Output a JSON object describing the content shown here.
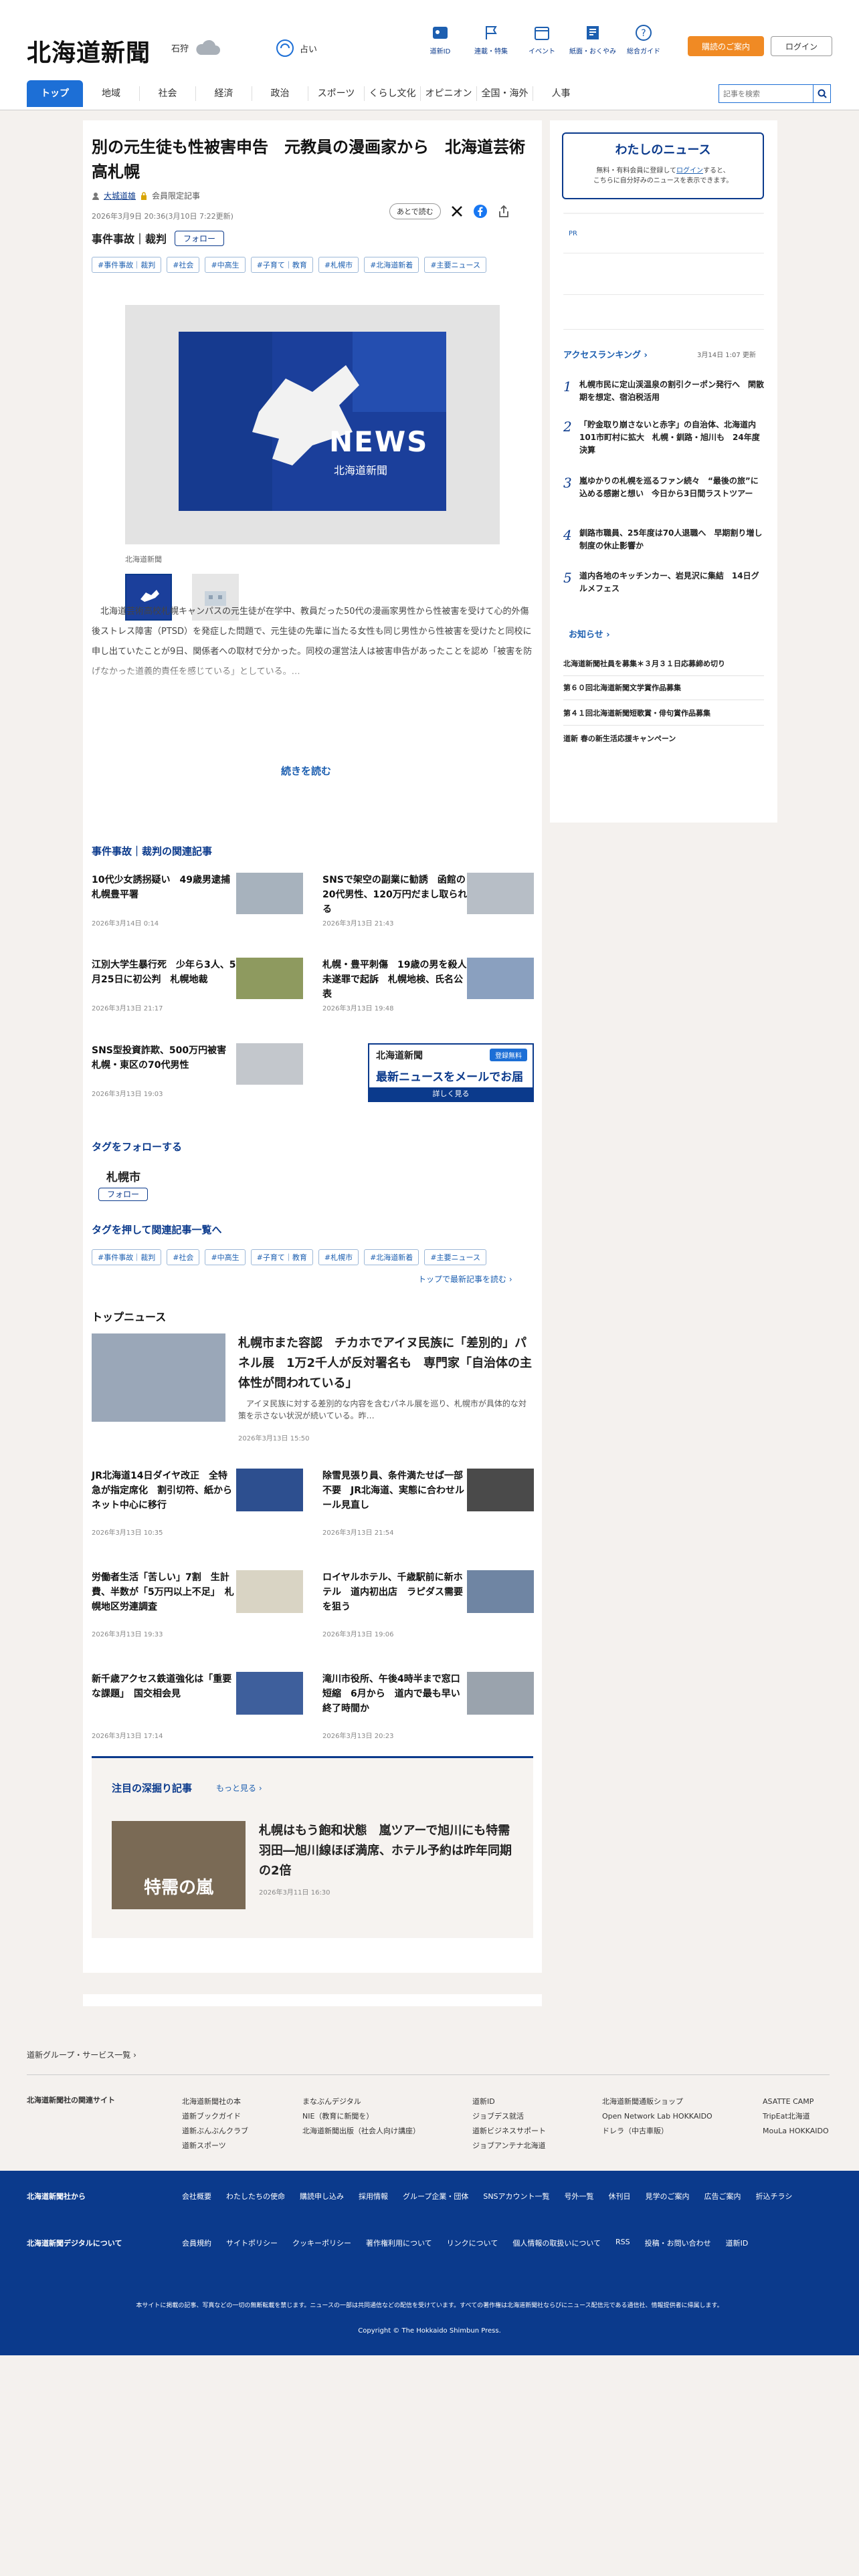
{
  "header": {
    "logo": "北海道新聞",
    "city": "石狩",
    "weather_note": "占い",
    "icons": [
      "道新ID",
      "連載・特集",
      "イベント",
      "紙面・おくやみ",
      "総合ガイド"
    ],
    "subscribe": "購読のご案内",
    "login": "ログイン"
  },
  "gnav": [
    "トップ",
    "地域",
    "社会",
    "経済",
    "政治",
    "スポーツ",
    "くらし文化",
    "オピニオン",
    "全国・海外",
    "人事"
  ],
  "search": {
    "placeholder": "記事を検索"
  },
  "article": {
    "title": "別の元生徒も性被害申告　元教員の漫画家から　北海道芸術高札幌",
    "author": "大城道雄",
    "member": "会員限定記事",
    "date": "2026年3月9日 20:36(3月10日 7:22更新)",
    "category": "事件事故｜裁判",
    "follow": "フォロー",
    "later": "あとで読む",
    "tags": [
      "#事件事故｜裁判",
      "#社会",
      "#中高生",
      "#子育て｜教育",
      "#札幌市",
      "#北海道新着",
      "#主要ニュース"
    ],
    "photo_caption": "北海道新聞",
    "news_mark": "NEWS",
    "news_sub": "北海道新聞",
    "body": "　北海道芸術高校札幌キャンパスの元生徒が在学中、教員だった50代の漫画家男性から性被害を受けて心的外傷後ストレス障害（PTSD）を発症した問題で、元生徒の先輩に当たる女性も同じ男性から性被害を受けたと同校に申し出ていたことが9日、関係者への取材で分かった。同校の運営法人は被害申告があったことを認め「被害を防げなかった道義的責任を感じている」としている。…",
    "read_more": "続きを読む"
  },
  "related": {
    "heading": "事件事故｜裁判の関連記事",
    "items": [
      {
        "t": "10代少女誘拐疑い　49歳男逮捕　札幌豊平署",
        "d": "2026年3月14日 0:14"
      },
      {
        "t": "SNSで架空の副業に勧誘　函館の20代男性、120万円だまし取られる",
        "d": "2026年3月13日 21:43"
      },
      {
        "t": "江別大学生暴行死　少年ら3人、5月25日に初公判　札幌地裁",
        "d": "2026年3月13日 21:17"
      },
      {
        "t": "札幌・豊平刺傷　19歳の男を殺人未遂罪で起訴　札幌地検、氏名公表",
        "d": "2026年3月13日 19:48"
      },
      {
        "t": "SNS型投資詐欺、500万円被害　札幌・東区の70代男性",
        "d": "2026年3月13日 19:03"
      }
    ],
    "ad_logo": "北海道新聞",
    "ad_free": "登録無料",
    "ad_title": "最新ニュースをメールでお届け",
    "ad_btn": "詳しく見る"
  },
  "tagfollow": {
    "heading": "タグをフォローする",
    "name": "札幌市",
    "btn": "フォロー",
    "heading2": "タグを押して関連記事一覧へ",
    "link": "トップで最新記事を読む"
  },
  "topnews": {
    "heading": "トップニュース",
    "lead": {
      "t": "札幌市また容認　チカホでアイヌ民族に「差別的」パネル展　1万2千人が反対署名も　専門家「自治体の主体性が問われている」",
      "s": "　アイヌ民族に対する差別的な内容を含むパネル展を巡り、札幌市が具体的な対策を示さない状況が続いている。昨…",
      "d": "2026年3月13日 15:50"
    },
    "items": [
      {
        "t": "JR北海道14日ダイヤ改正　全特急が指定席化　割引切符、紙からネット中心に移行",
        "d": "2026年3月13日 10:35"
      },
      {
        "t": "除雪見張り員、条件満たせば一部不要　JR北海道、実態に合わせルール見直し",
        "d": "2026年3月13日 21:54"
      },
      {
        "t": "労働者生活「苦しい」7割　生計費、半数が「5万円以上不足」　札幌地区労連調査",
        "d": "2026年3月13日 19:33"
      },
      {
        "t": "ロイヤルホテル、千歳駅前に新ホテル　道内初出店　ラピダス需要を狙う",
        "d": "2026年3月13日 19:06"
      },
      {
        "t": "新千歳アクセス鉄道強化は「重要な課題」　国交相会見",
        "d": "2026年3月13日 17:14"
      },
      {
        "t": "滝川市役所、午後4時半まで窓口短縮　6月から　道内で最も早い終了時間か",
        "d": "2026年3月13日 20:23"
      }
    ]
  },
  "feature": {
    "heading": "注目の深掘り記事",
    "more": "もっと見る",
    "t": "札幌はもう飽和状態　嵐ツアーで旭川にも特需　羽田―旭川線ほぼ満席、ホテル予約は昨年同期の2倍",
    "d": "2026年3月11日 16:30",
    "img_text": "特需の嵐"
  },
  "sidebar": {
    "my_title": "わたしのニュース",
    "my_text1": "無料・有料会員に登録して",
    "my_link": "ログイン",
    "my_text2": "すると、",
    "my_text3": "こちらに自分好みのニュースを表示できます。",
    "pr": "PR",
    "rank_heading": "アクセスランキング",
    "rank_date": "3月14日 1:07 更新",
    "ranks": [
      "札幌市民に定山渓温泉の割引クーポン発行へ　閑散期を想定、宿泊税活用",
      "「貯金取り崩さないと赤字」の自治体、北海道内101市町村に拡大　札幌・釧路・旭川も　24年度決算",
      "嵐ゆかりの札幌を巡るファン続々　“最後の旅”に込める感謝と想い　今日から3日間ラストツアー",
      "釧路市職員、25年度は70人退職へ　早期割り増し制度の休止影響か",
      "道内各地のキッチンカー、岩見沢に集結　14日グルメフェス"
    ],
    "notice_heading": "お知らせ",
    "notices": [
      "北海道新聞社員を募集＊３月３１日応募締め切り",
      "第６０回北海道新聞文学賞作品募集",
      "第４１回北海道新聞短歌賞・俳句賞作品募集",
      "道新 春の新生活応援キャンペーン"
    ]
  },
  "footer": {
    "group": "道新グループ・サービス一覧",
    "related_label": "北海道新聞社の関連サイト",
    "links": [
      [
        "北海道新聞社の本",
        "道新ブックガイド",
        "道新ぶんぶんクラブ",
        "道新スポーツ"
      ],
      [
        "まなぶんデジタル",
        "NIE（教育に新聞を）",
        "北海道新聞出版（社会人向け講座）"
      ],
      [
        "道新ID",
        "ジョブデス就活",
        "道新ビジネスサポート",
        "ジョブアンテナ北海道"
      ],
      [
        "北海道新聞通販ショップ",
        "Open Network Lab HOKKAIDO",
        "ドレラ（中古車販）"
      ],
      [
        "ASATTE CAMP",
        "TripEat北海道",
        "MouLa HOKKAIDO"
      ]
    ],
    "from_label": "北海道新聞社から",
    "from_links": [
      "会社概要",
      "わたしたちの使命",
      "購読申し込み",
      "採用情報",
      "グループ企業・団体",
      "SNSアカウント一覧",
      "号外一覧",
      "休刊日",
      "見学のご案内",
      "広告ご案内",
      "折込チラシ"
    ],
    "digital_label": "北海道新聞デジタルについて",
    "digital_links": [
      "会員規約",
      "サイトポリシー",
      "クッキーポリシー",
      "著作権利用について",
      "リンクについて",
      "個人情報の取扱いについて",
      "RSS",
      "投稿・お問い合わせ",
      "道新ID"
    ],
    "notice": "本サイトに掲載の記事、写真などの一切の無断転載を禁じます。ニュースの一部は共同通信などの配信を受けています。すべての著作権は北海道新聞社ならびにニュース配信元である通信社、情報提供者に帰属します。",
    "copyright": "Copyright © The Hokkaido Shimbun Press."
  }
}
